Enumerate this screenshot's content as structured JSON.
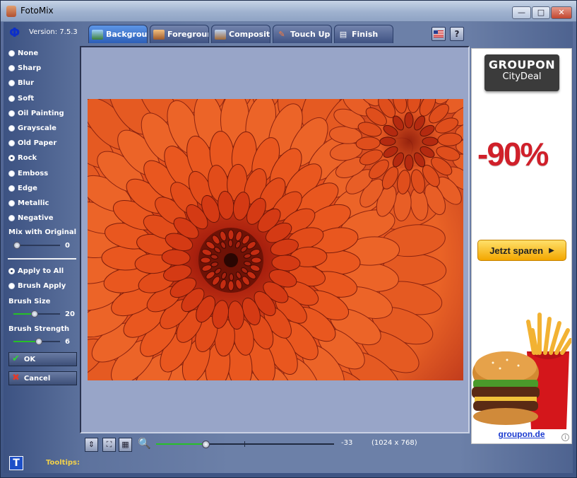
{
  "window": {
    "title": "FotoMix",
    "minimize": "—",
    "maximize": "□",
    "close": "✕"
  },
  "app": {
    "logo_glyph": "Φ",
    "version_label": "Version: 7.5.3"
  },
  "tabs": [
    {
      "label": "Backgroun",
      "icon": "background-tab-icon",
      "active": true
    },
    {
      "label": "Foregroun",
      "icon": "foreground-tab-icon",
      "active": false
    },
    {
      "label": "Compositio",
      "icon": "composition-tab-icon",
      "active": false
    },
    {
      "label": "Touch Up",
      "icon": "brush-icon",
      "active": false
    },
    {
      "label": "Finish",
      "icon": "finish-icon",
      "active": false
    }
  ],
  "header_buttons": {
    "language": "flag-icon",
    "help_label": "?"
  },
  "effects": {
    "options": [
      "None",
      "Sharp",
      "Blur",
      "Soft",
      "Oil Painting",
      "Grayscale",
      "Old Paper",
      "Rock",
      "Emboss",
      "Edge",
      "Metallic",
      "Negative"
    ],
    "selected": "Rock"
  },
  "mix": {
    "label": "Mix with Original",
    "value": "0",
    "fraction": 0.0
  },
  "apply": {
    "options": [
      "Apply to All",
      "Brush Apply"
    ],
    "selected": "Apply to All"
  },
  "brush_size": {
    "label": "Brush Size",
    "value": "20",
    "fraction": 0.45
  },
  "brush_strength": {
    "label": "Brush Strength",
    "value": "6",
    "fraction": 0.55
  },
  "buttons": {
    "ok_label": "OK",
    "cancel_label": "Cancel"
  },
  "zoom": {
    "value": "-33",
    "fraction": 0.27,
    "dimensions": "(1024 x 768)"
  },
  "ad": {
    "logo_line1": "GROUPON",
    "logo_line2": "CityDeal",
    "discount": "-90%",
    "cta": "Jetzt sparen",
    "url": "groupon.de",
    "info": "i"
  },
  "footer": {
    "t_button": "T",
    "tooltips_label": "Tooltips:"
  },
  "colors": {
    "accent_active_tab": "#2c5fb8",
    "ad_red": "#d0202a",
    "slider_green": "#27c027",
    "tooltips_yellow": "#f2d14a"
  }
}
